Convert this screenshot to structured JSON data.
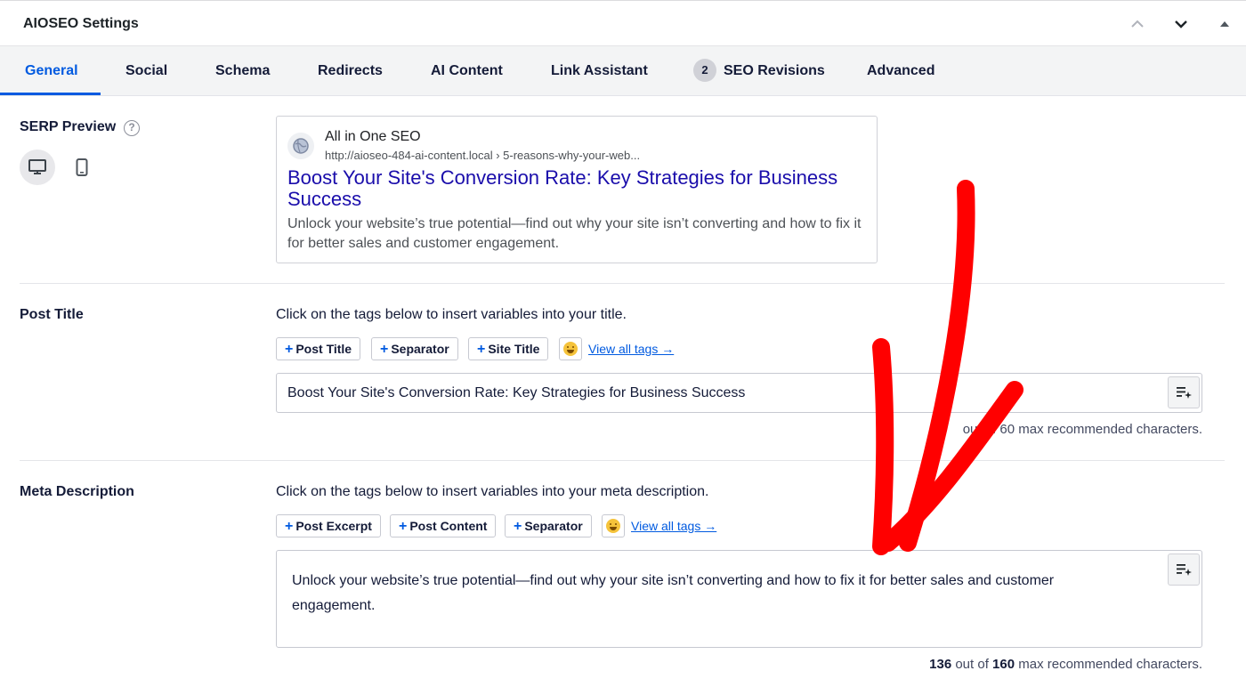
{
  "header": {
    "title": "AIOSEO Settings"
  },
  "tabs": [
    {
      "label": "General",
      "active": true
    },
    {
      "label": "Social"
    },
    {
      "label": "Schema"
    },
    {
      "label": "Redirects"
    },
    {
      "label": "AI Content"
    },
    {
      "label": "Link Assistant"
    },
    {
      "label": "SEO Revisions",
      "badge": "2"
    },
    {
      "label": "Advanced"
    }
  ],
  "serp": {
    "label": "SERP Preview",
    "help_glyph": "?",
    "site_name": "All in One SEO",
    "url": "http://aioseo-484-ai-content.local › 5-reasons-why-your-web...",
    "title": "Boost Your Site's Conversion Rate: Key Strategies for Business Success",
    "description": "Unlock your website’s true potential—find out why your site isn’t converting and how to fix it for better sales and customer engagement."
  },
  "post_title": {
    "label": "Post Title",
    "helper": "Click on the tags below to insert variables into your title.",
    "tags": [
      "Post Title",
      "Separator",
      "Site Title"
    ],
    "view_all": "View all tags →",
    "value": "Boost Your Site's Conversion Rate: Key Strategies for Business Success",
    "counter_text": "out of 60 max recommended characters."
  },
  "meta_description": {
    "label": "Meta Description",
    "helper": "Click on the tags below to insert variables into your meta description.",
    "tags": [
      "Post Excerpt",
      "Post Content",
      "Separator"
    ],
    "view_all": "View all tags →",
    "value": "Unlock your website’s true potential—find out why your site isn’t converting and how to fix it for better sales and customer engagement.",
    "counter_current": "136",
    "counter_mid": " out of ",
    "counter_max": "160",
    "counter_suffix": " max recommended characters."
  },
  "colors": {
    "accent": "#005ae0",
    "serp_title": "#1a0dab",
    "annotation": "#ff0000"
  },
  "icons": [
    "chevron-up-icon",
    "chevron-down-icon",
    "caret-up-icon",
    "help-icon",
    "desktop-icon",
    "mobile-icon",
    "globe-icon",
    "plus-icon",
    "emoji-icon",
    "ai-sparkle-icon"
  ]
}
